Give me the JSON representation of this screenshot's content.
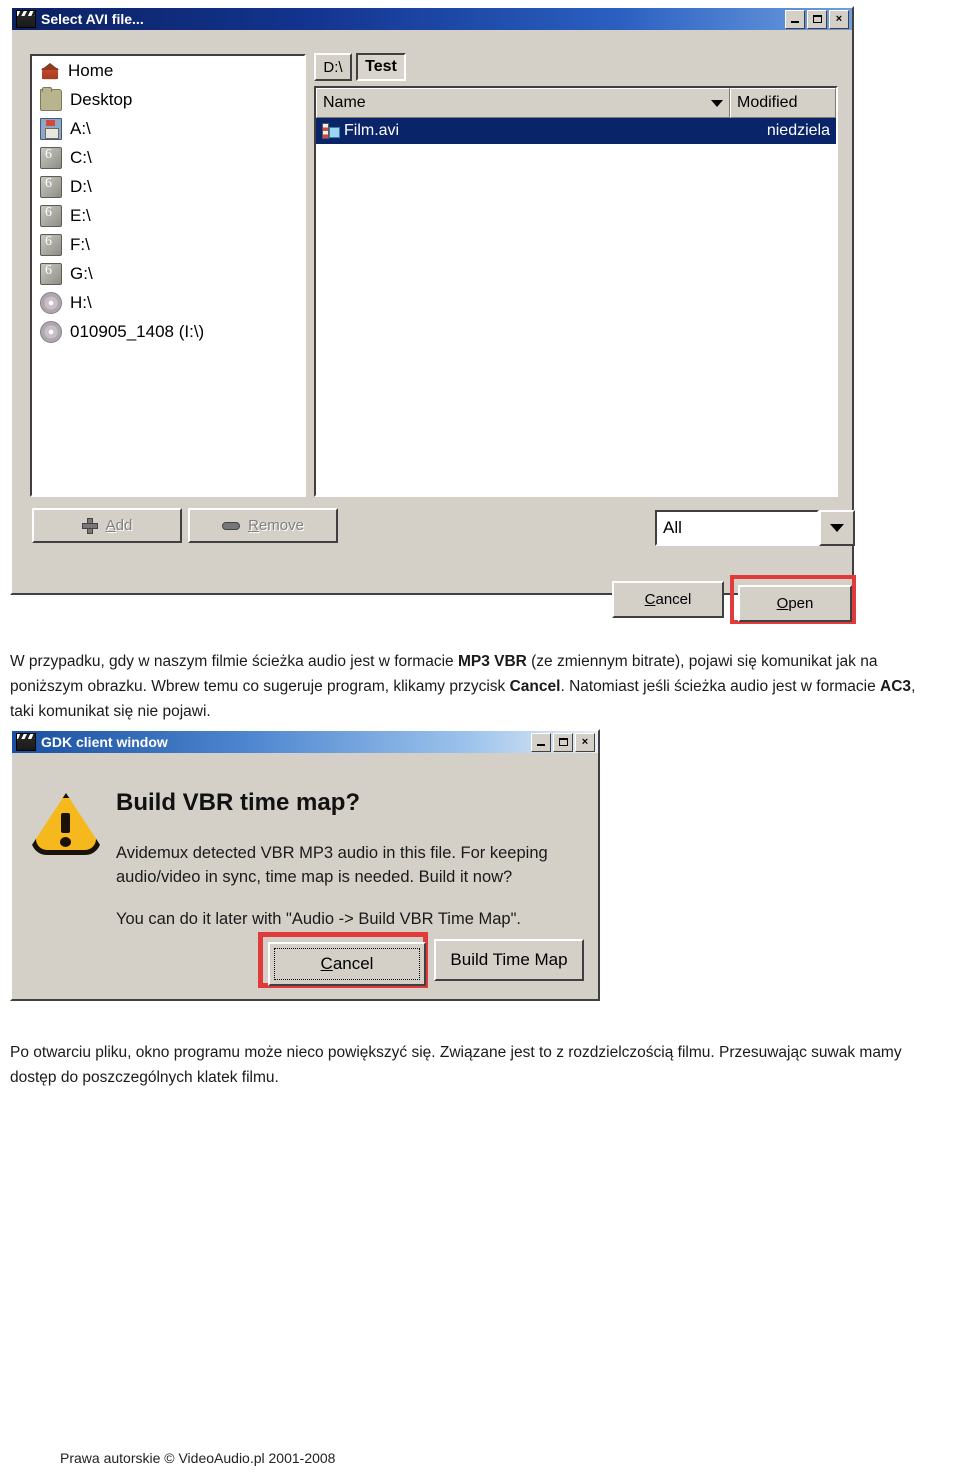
{
  "file_dialog": {
    "title": "Select AVI file...",
    "icon": "film-clapper-icon",
    "window_buttons": {
      "minimize": "_",
      "maximize": "□",
      "close": "×"
    },
    "places": [
      {
        "label": "Home",
        "icon": "home-icon"
      },
      {
        "label": "Desktop",
        "icon": "folder-icon"
      },
      {
        "label": "A:\\",
        "icon": "floppy-icon"
      },
      {
        "label": "C:\\",
        "icon": "harddisk-icon"
      },
      {
        "label": "D:\\",
        "icon": "harddisk-icon"
      },
      {
        "label": "E:\\",
        "icon": "harddisk-icon"
      },
      {
        "label": "F:\\",
        "icon": "harddisk-icon"
      },
      {
        "label": "G:\\",
        "icon": "harddisk-icon"
      },
      {
        "label": "H:\\",
        "icon": "cdrom-icon"
      },
      {
        "label": "010905_1408 (I:\\)",
        "icon": "cdrom-icon"
      }
    ],
    "breadcrumb": [
      {
        "label": "D:\\",
        "active": false
      },
      {
        "label": "Test",
        "active": true
      }
    ],
    "columns": {
      "name": "Name",
      "modified": "Modified"
    },
    "rows": [
      {
        "name": "Film.avi",
        "modified": "niedziela",
        "selected": true,
        "icon": "avi-file-icon"
      }
    ],
    "add_label": "Add",
    "add_mnemonic": "A",
    "remove_label": "Remove",
    "remove_mnemonic": "R",
    "filter_value": "All",
    "cancel_label": "Cancel",
    "cancel_mnemonic": "C",
    "open_label": "Open",
    "open_mnemonic": "O",
    "highlight_color": "#e03a3a"
  },
  "paragraph1": {
    "part1": "W przypadku, gdy w naszym filmie ścieżka audio jest w formacie ",
    "bold1": "MP3 VBR",
    "part2": " (ze zmiennym bitrate), pojawi się komunikat jak na poniższym obrazku. Wbrew temu co sugeruje program, klikamy przycisk ",
    "bold2": "Cancel",
    "part3": ". Natomiast jeśli ścieżka audio jest w formacie ",
    "bold3": "AC3",
    "part4": ", taki komunikat się nie pojawi."
  },
  "gdk_dialog": {
    "title": "GDK client window",
    "icon": "film-clapper-icon",
    "window_buttons": {
      "minimize": "_",
      "maximize": "□",
      "close": "×"
    },
    "warning_icon": "warning-triangle-icon",
    "heading": "Build VBR time map?",
    "body": "Avidemux detected VBR MP3 audio in this file. For keeping audio/video in sync, time map is needed. Build it now?",
    "note": "You can do it later with \"Audio -> Build VBR Time Map\".",
    "cancel_label": "Cancel",
    "cancel_mnemonic": "C",
    "build_label": "Build Time Map",
    "highlight_color": "#e03a3a"
  },
  "paragraph2": {
    "text": "Po otwarciu pliku, okno programu może nieco powiększyć się. Związane jest to z rozdzielczością filmu. Przesuwając suwak mamy dostęp do poszczególnych klatek filmu."
  },
  "footer": {
    "copyright": "Prawa autorskie © VideoAudio.pl 2001-2008"
  }
}
